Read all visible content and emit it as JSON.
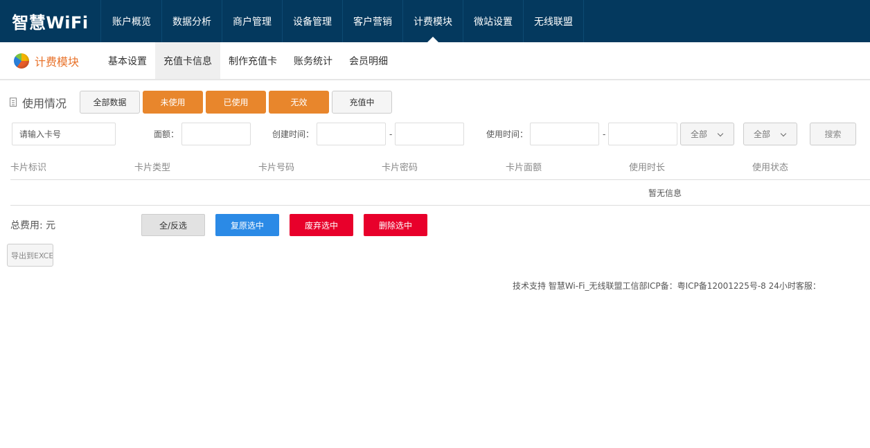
{
  "brand": "智慧WiFi",
  "nav": [
    {
      "label": "账户概览",
      "name": "nav-account-overview"
    },
    {
      "label": "数据分析",
      "name": "nav-data-analysis"
    },
    {
      "label": "商户管理",
      "name": "nav-merchant-management"
    },
    {
      "label": "设备管理",
      "name": "nav-device-management"
    },
    {
      "label": "客户营销",
      "name": "nav-customer-marketing"
    },
    {
      "label": "计费模块",
      "name": "nav-billing-module"
    },
    {
      "label": "微站设置",
      "name": "nav-microsite-settings"
    },
    {
      "label": "无线联盟",
      "name": "nav-wireless-alliance"
    }
  ],
  "module": {
    "title": "计费模块",
    "icon": "pie-chart-icon",
    "tabs": [
      {
        "label": "基本设置"
      },
      {
        "label": "充值卡信息"
      },
      {
        "label": "制作充值卡"
      },
      {
        "label": "账务统计"
      },
      {
        "label": "会员明细"
      }
    ]
  },
  "usage": {
    "label": "使用情况",
    "filters": [
      {
        "label": "全部数据",
        "style": "gray"
      },
      {
        "label": "未使用",
        "style": "orange"
      },
      {
        "label": "已使用",
        "style": "orange"
      },
      {
        "label": "无效",
        "style": "orange"
      },
      {
        "label": "充值中",
        "style": "gray"
      }
    ]
  },
  "search": {
    "card_placeholder": "请输入卡号",
    "amount_label": "面额：",
    "create_time_label": "创建时间：",
    "use_time_label": "使用时间：",
    "range_separator": "-",
    "select1": "全部",
    "select2": "全部",
    "button": "搜索"
  },
  "table": {
    "headers": [
      "卡片标识",
      "卡片类型",
      "卡片号码",
      "卡片密码",
      "卡片面额",
      "使用时长",
      "使用状态"
    ],
    "empty_text": "暂无信息"
  },
  "actions": {
    "total_label": "总费用: 元",
    "toggle_all": "全/反选",
    "restore": "复原选中",
    "discard": "废弃选中",
    "delete": "删除选中",
    "export": "导出到EXCEL"
  },
  "footer": {
    "copyright": "技术支持 智慧Wi-Fi_无线联盟工信部ICP备：粤ICP备12001225号-8 24小时客服："
  },
  "colors": {
    "topbar": "#04395e",
    "accent_orange": "#e8862c",
    "blue_button": "#2b8ae6",
    "red_button": "#e8002b"
  }
}
